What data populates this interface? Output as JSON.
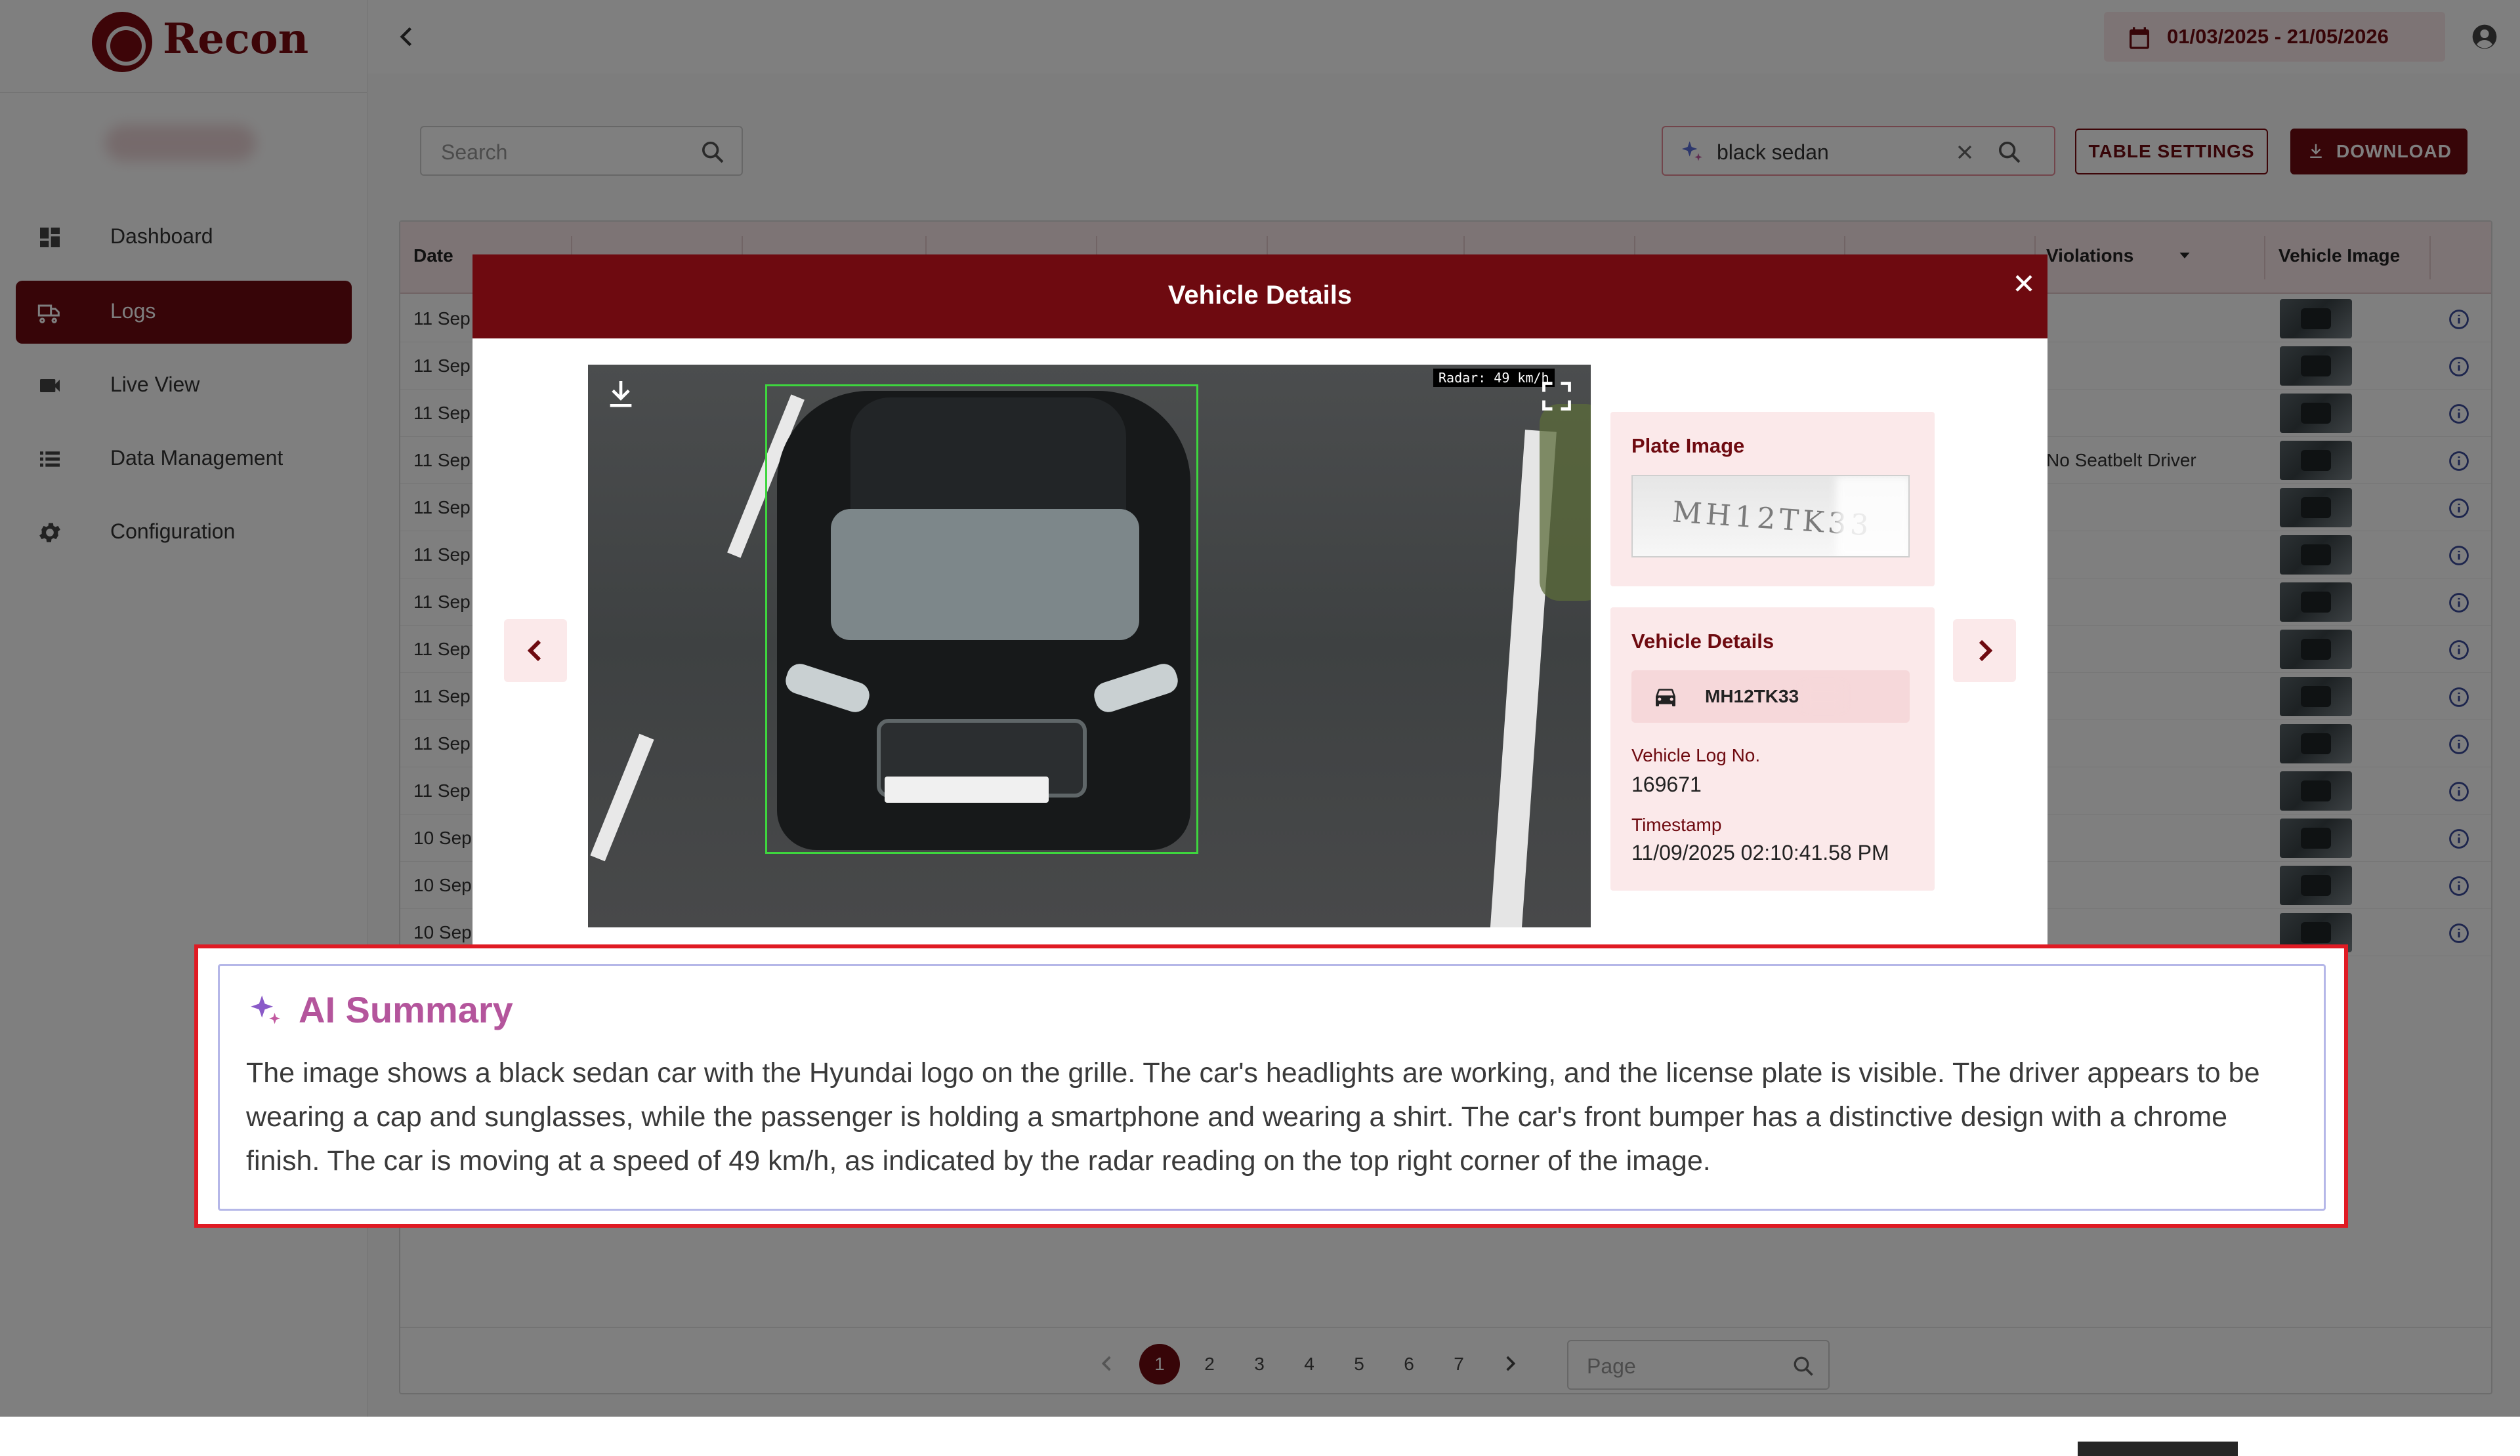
{
  "app": {
    "name": "Recon"
  },
  "sidebar": {
    "items": [
      {
        "label": "Dashboard",
        "icon": "dashboard-icon"
      },
      {
        "label": "Logs",
        "icon": "truck-icon",
        "active": true
      },
      {
        "label": "Live View",
        "icon": "video-camera-icon"
      },
      {
        "label": "Data Management",
        "icon": "list-icon"
      },
      {
        "label": "Configuration",
        "icon": "gear-icon"
      }
    ]
  },
  "topbar": {
    "date_range": "01/03/2025 - 21/05/2026"
  },
  "toolbar": {
    "search_placeholder": "Search",
    "ai_search_value": "black sedan",
    "table_settings_label": "TABLE SETTINGS",
    "download_label": "DOWNLOAD"
  },
  "table": {
    "columns": [
      "Date",
      "Violations",
      "Vehicle Image"
    ],
    "rows": [
      {
        "date": "11 Sep",
        "violation": ""
      },
      {
        "date": "11 Sep",
        "violation": ""
      },
      {
        "date": "11 Sep",
        "violation": ""
      },
      {
        "date": "11 Sep",
        "violation": "No Seatbelt Driver"
      },
      {
        "date": "11 Sep",
        "violation": ""
      },
      {
        "date": "11 Sep",
        "violation": ""
      },
      {
        "date": "11 Sep",
        "violation": ""
      },
      {
        "date": "11 Sep",
        "violation": ""
      },
      {
        "date": "11 Sep",
        "violation": ""
      },
      {
        "date": "11 Sep",
        "violation": ""
      },
      {
        "date": "11 Sep",
        "violation": ""
      },
      {
        "date": "10 Sep",
        "violation": ""
      },
      {
        "date": "10 Sep",
        "violation": ""
      },
      {
        "date": "10 Sep",
        "violation": ""
      }
    ]
  },
  "pagination": {
    "pages": [
      "1",
      "2",
      "3",
      "4",
      "5",
      "6",
      "7"
    ],
    "current": "1",
    "page_placeholder": "Page"
  },
  "modal": {
    "title": "Vehicle Details",
    "radar_overlay": "Radar: 49 km/h",
    "plate_image_title": "Plate Image",
    "plate_image_text": "MH12TK33",
    "details_title": "Vehicle Details",
    "vehicle_number": "MH12TK33",
    "log_no_label": "Vehicle Log No.",
    "log_no_value": "169671",
    "timestamp_label": "Timestamp",
    "timestamp_value": "11/09/2025 02:10:41.58 PM"
  },
  "ai_summary": {
    "title": "AI Summary",
    "text": "The image shows a black sedan car with the Hyundai logo on the grille. The car's headlights are working, and the license plate is visible. The driver appears to be wearing a cap and sunglasses, while the passenger is holding a smartphone and wearing a shirt. The car's front bumper has a distinctive design with a chrome finish. The car is moving at a speed of 49 km/h, as indicated by the radar reading on the top right corner of the image."
  },
  "colors": {
    "brand": "#6e0a10",
    "brand_light": "#fbe9ea",
    "callout_border": "#e01b24",
    "ai_title": "#b4559c"
  }
}
